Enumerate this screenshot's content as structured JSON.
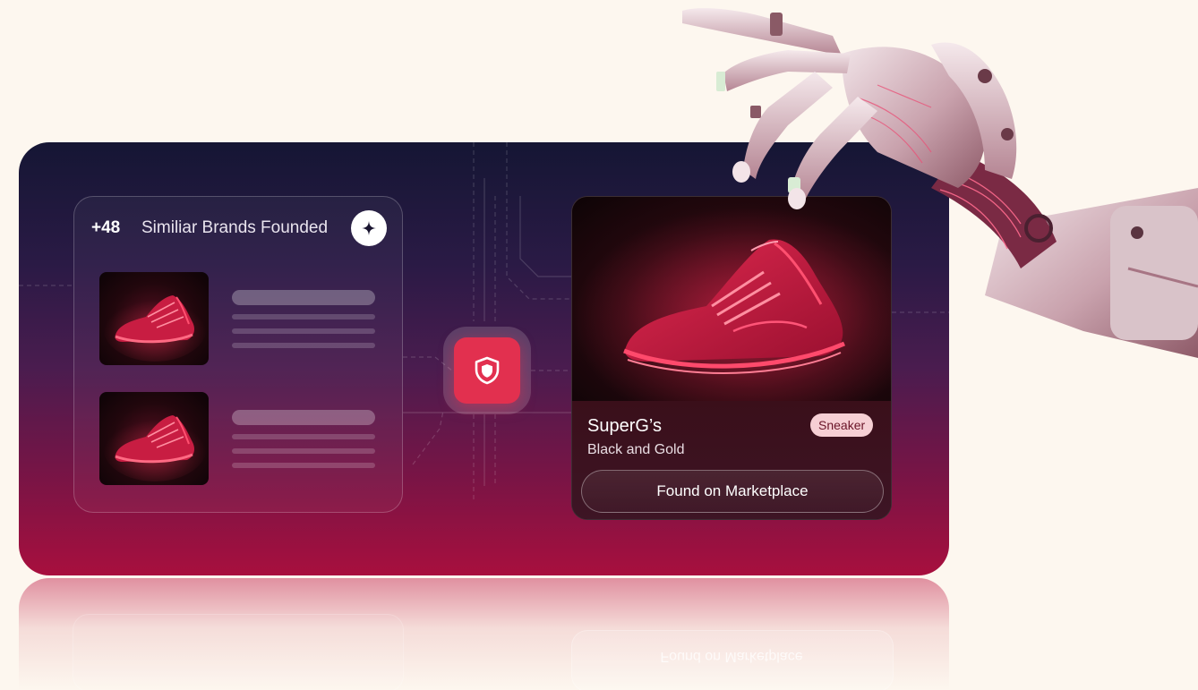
{
  "brands_panel": {
    "count": "+48",
    "title": "Similiar Brands Founded",
    "add_icon": "sparkle-plus-icon"
  },
  "center": {
    "icon": "shield-icon",
    "accent": "#e2304f"
  },
  "product": {
    "name": "SuperG’s",
    "subtitle": "Black and Gold",
    "badge": "Sneaker",
    "action": "Found on Marketplace",
    "reflection_text": "Found on Marketplace"
  },
  "colors": {
    "background": "#fdf7ef",
    "panel_top": "#151634",
    "panel_bottom": "#a80f3e",
    "badge_bg": "#f6cfd4"
  }
}
